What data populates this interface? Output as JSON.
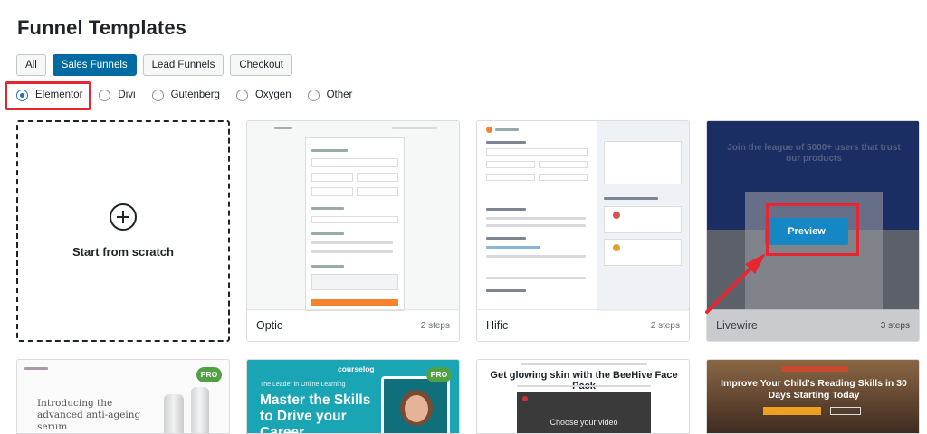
{
  "page_title": "Funnel Templates",
  "tabs": [
    {
      "label": "All",
      "active": false
    },
    {
      "label": "Sales Funnels",
      "active": true
    },
    {
      "label": "Lead Funnels",
      "active": false
    },
    {
      "label": "Checkout",
      "active": false
    }
  ],
  "builders": [
    {
      "label": "Elementor",
      "checked": true
    },
    {
      "label": "Divi",
      "checked": false
    },
    {
      "label": "Gutenberg",
      "checked": false
    },
    {
      "label": "Oxygen",
      "checked": false
    },
    {
      "label": "Other",
      "checked": false
    }
  ],
  "scratch": {
    "label": "Start from scratch",
    "icon": "plus-circle-icon"
  },
  "templates": [
    {
      "name": "Optic",
      "steps": "2 steps"
    },
    {
      "name": "Hific",
      "steps": "2 steps"
    },
    {
      "name": "Livewire",
      "steps": "3 steps",
      "preview_label": "Preview",
      "headline": "Join the league of 5000+ users that trust our products"
    }
  ],
  "row2": [
    {
      "badge": "PRO",
      "headline": "Introducing the advanced anti-ageing serum"
    },
    {
      "badge": "PRO",
      "logo": "courselog",
      "kicker": "The Leader in Online Learning",
      "headline": "Master the Skills to Drive your Career."
    },
    {
      "headline": "Get glowing skin with the BeeHive Face Pack",
      "video_caption": "Choose your video"
    },
    {
      "headline": "Improve Your Child's Reading Skills in 30 Days Starting Today"
    }
  ],
  "colors": {
    "primary": "#006ba1",
    "highlight": "#e62630",
    "pro": "#51a043",
    "teal": "#1aa5b5"
  }
}
